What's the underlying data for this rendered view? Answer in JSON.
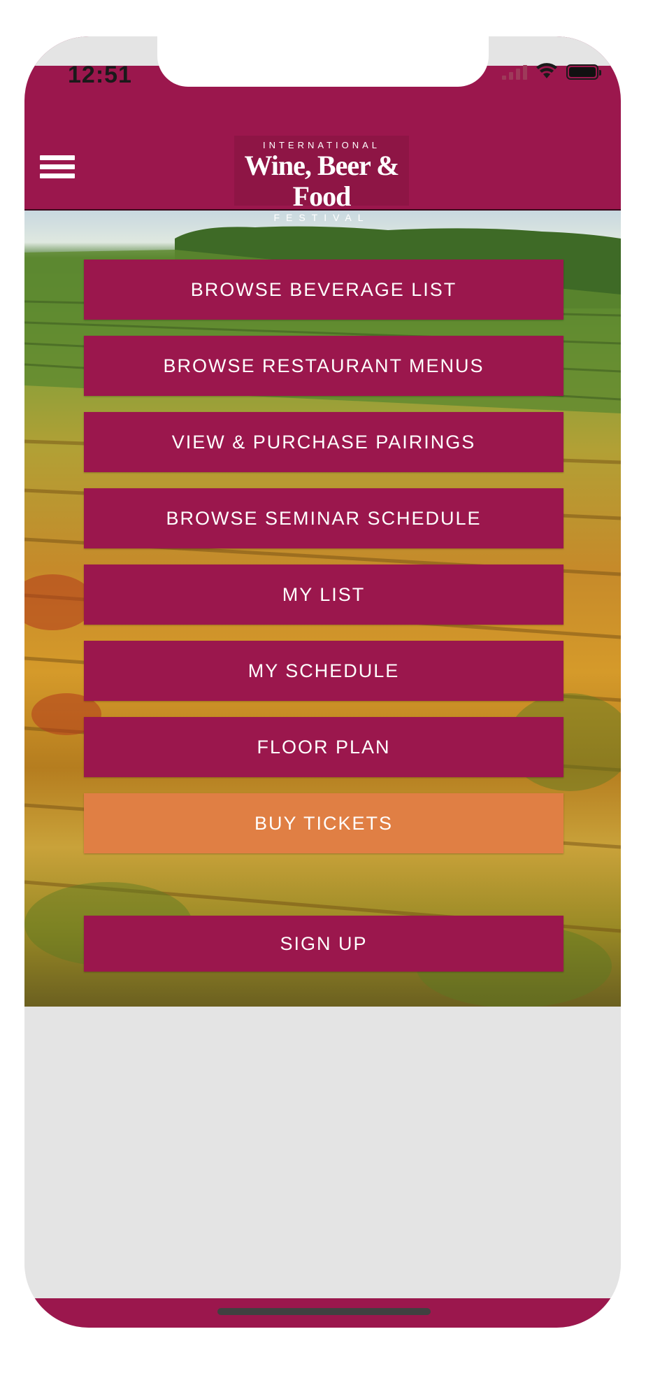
{
  "status_bar": {
    "time": "12:51"
  },
  "header": {
    "menu_icon": "hamburger-menu-icon",
    "logo": {
      "line1": "INTERNATIONAL",
      "line2": "Wine, Beer & Food",
      "line3": "FESTIVAL"
    }
  },
  "menu": {
    "items": [
      {
        "label": "BROWSE BEVERAGE LIST"
      },
      {
        "label": "BROWSE RESTAURANT MENUS"
      },
      {
        "label": "VIEW & PURCHASE PAIRINGS"
      },
      {
        "label": "BROWSE SEMINAR SCHEDULE"
      },
      {
        "label": "MY LIST"
      },
      {
        "label": "MY SCHEDULE"
      },
      {
        "label": "FLOOR PLAN"
      },
      {
        "label": "BUY TICKETS"
      },
      {
        "label": "SIGN UP"
      }
    ]
  },
  "colors": {
    "brand": "#9b174d",
    "accent": "#e07f44",
    "background": "#e4e4e4"
  }
}
